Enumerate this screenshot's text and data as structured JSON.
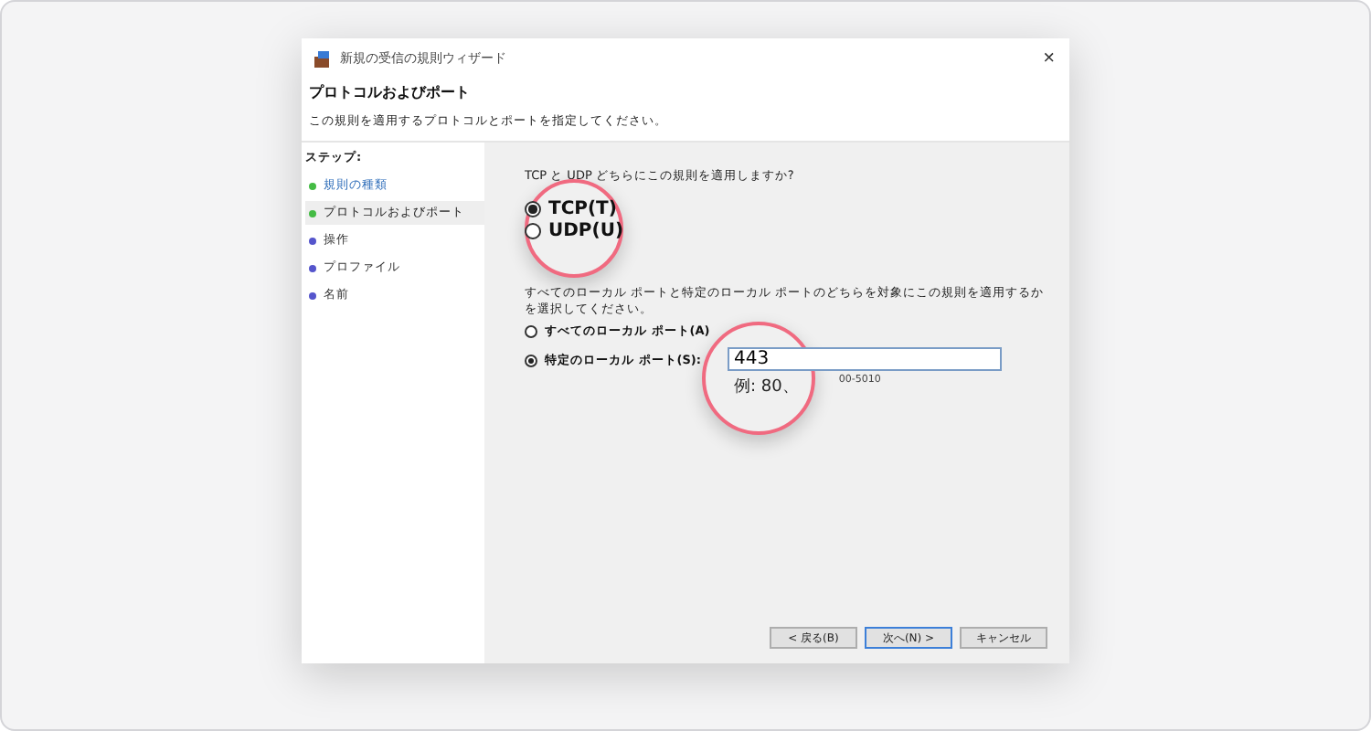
{
  "window": {
    "title": "新規の受信の規則ウィザード",
    "close": "×"
  },
  "header": {
    "title": "プロトコルおよびポート",
    "subtitle": "この規則を適用するプロトコルとポートを指定してください。"
  },
  "steps": {
    "label": "ステップ:",
    "items": [
      {
        "label": "規則の種類",
        "selected": false,
        "color": "#44bb44"
      },
      {
        "label": "プロトコルおよびポート",
        "selected": true,
        "color": "#44bb44"
      },
      {
        "label": "操作",
        "selected": false,
        "color": "#5555cc"
      },
      {
        "label": "プロファイル",
        "selected": false,
        "color": "#5555cc"
      },
      {
        "label": "名前",
        "selected": false,
        "color": "#5555cc"
      }
    ]
  },
  "protocol": {
    "magnified": true,
    "question": "TCP と UDP どちらにこの規則を適用しますか?",
    "options": [
      {
        "label": "TCP(T)",
        "selected": true
      },
      {
        "label": "UDP(U)",
        "selected": false
      }
    ]
  },
  "ports": {
    "magnified": true,
    "question": "すべてのローカル ポートと特定のローカル ポートのどちらを対象にこの規則を適用するかを選択してください。",
    "options": [
      {
        "label": "すべてのローカル ポート(A)",
        "selected": false
      },
      {
        "label": "特定のローカル ポート(S):",
        "selected": true
      }
    ],
    "value": "443",
    "hint_magnified": "例: 80、",
    "hint_tail": "00-5010"
  },
  "buttons": [
    {
      "label": "< 戻る(B)",
      "primary": false
    },
    {
      "label": "次へ(N) >",
      "primary": true
    },
    {
      "label": "キャンセル",
      "primary": false
    }
  ]
}
